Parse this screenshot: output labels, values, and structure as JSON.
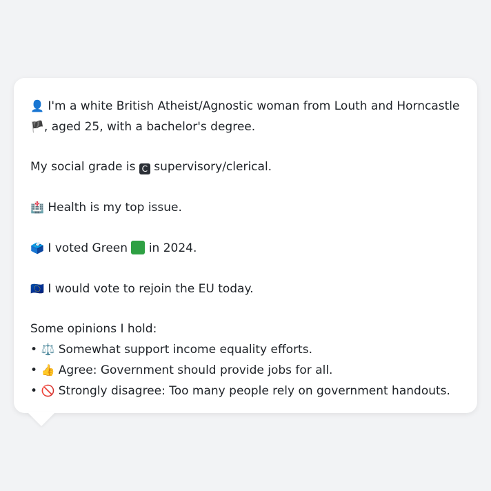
{
  "card": {
    "intro_line1": "I'm a white British Atheist/Agnostic woman from Louth and Horncastle",
    "intro_line2": ", aged 25, with a bachelor's degree.",
    "grade_prefix": "My social grade is ",
    "grade_letter": "C",
    "grade_suffix": " supervisory/clerical.",
    "issue": " Health is my top issue.",
    "vote_prefix": " I voted Green ",
    "vote_suffix": " in 2024.",
    "eu": " I would vote to rejoin the EU today.",
    "opinions_heading": "Some opinions I hold:",
    "opinions": [
      {
        "bullet": "•",
        "icon": "⚖️",
        "text": " Somewhat support income equality efforts."
      },
      {
        "bullet": "•",
        "icon": "👍",
        "text": " Agree: Government should provide jobs for all."
      },
      {
        "bullet": "•",
        "icon": "🚫",
        "text": " Strongly disagree: Too many people rely on government handouts."
      }
    ],
    "icons": {
      "person": "👤",
      "flag": "🏴",
      "hospital": "🏥",
      "ballot": "🗳️",
      "eu": "🇪🇺"
    }
  }
}
